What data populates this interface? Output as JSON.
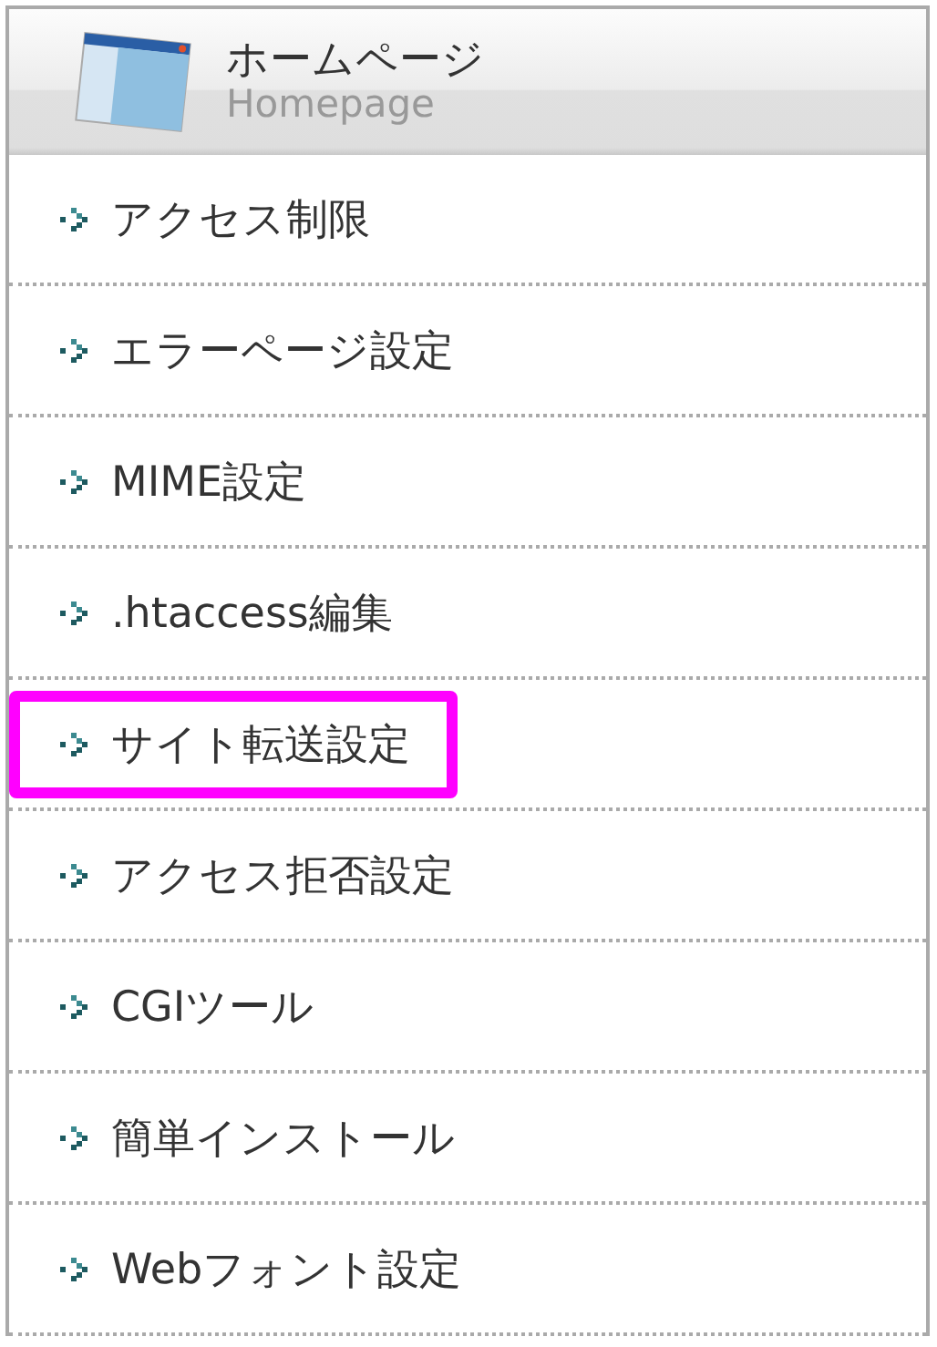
{
  "header": {
    "title": "ホームページ",
    "subtitle": "Homepage"
  },
  "items": [
    {
      "label": "アクセス制限",
      "selected": false
    },
    {
      "label": "エラーページ設定",
      "selected": false
    },
    {
      "label": "MIME設定",
      "selected": false
    },
    {
      "label": ".htaccess編集",
      "selected": false
    },
    {
      "label": "サイト転送設定",
      "selected": true
    },
    {
      "label": "アクセス拒否設定",
      "selected": false
    },
    {
      "label": "CGIツール",
      "selected": false
    },
    {
      "label": "簡単インストール",
      "selected": false
    },
    {
      "label": "Webフォント設定",
      "selected": false
    }
  ]
}
